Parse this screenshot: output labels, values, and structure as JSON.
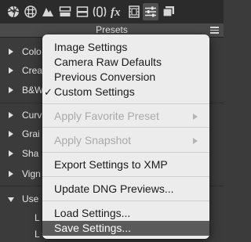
{
  "toolbar": {
    "icons": [
      "aperture-icon",
      "grid-icon",
      "mountains-icon",
      "split-tone-icon",
      "detail-icon",
      "lens-icon",
      "fx-icon",
      "film-strip-icon",
      "presets-sliders-icon",
      "snapshots-icon"
    ],
    "active": "presets-sliders-icon"
  },
  "panel": {
    "title": "Presets"
  },
  "presets": [
    {
      "label": "Colo",
      "expanded": false
    },
    {
      "label": "Crea",
      "expanded": false
    },
    {
      "label": "B&W",
      "expanded": false
    },
    {
      "label": "Curv",
      "expanded": false
    },
    {
      "label": "Grai",
      "expanded": false
    },
    {
      "label": "Sha",
      "expanded": false
    },
    {
      "label": "Vign",
      "expanded": false
    },
    {
      "label": "Use",
      "expanded": true
    }
  ],
  "sub_items": [
    {
      "label": "L"
    },
    {
      "label": "L"
    }
  ],
  "menu": {
    "items": [
      {
        "label": "Image Settings",
        "checked": false,
        "disabled": false
      },
      {
        "label": "Camera Raw Defaults",
        "checked": false,
        "disabled": false
      },
      {
        "label": "Previous Conversion",
        "checked": false,
        "disabled": false
      },
      {
        "label": "Custom Settings",
        "checked": true,
        "check_glyph": "✓",
        "disabled": false
      },
      {
        "label": "Apply Favorite Preset",
        "disabled": true,
        "submenu": true
      },
      {
        "label": "Apply Snapshot",
        "disabled": true,
        "submenu": true
      },
      {
        "label": "Export Settings to XMP",
        "disabled": false
      },
      {
        "label": "Update DNG Previews...",
        "disabled": false
      },
      {
        "label": "Load Settings...",
        "disabled": false
      },
      {
        "label": "Save Settings...",
        "disabled": false,
        "selected": true
      }
    ]
  },
  "colors": {
    "toolbar_bg": "#2b2b2b",
    "panel_bg": "#3b3b3b",
    "menu_bg": "#ececec",
    "highlight": "#5a5a5a"
  }
}
